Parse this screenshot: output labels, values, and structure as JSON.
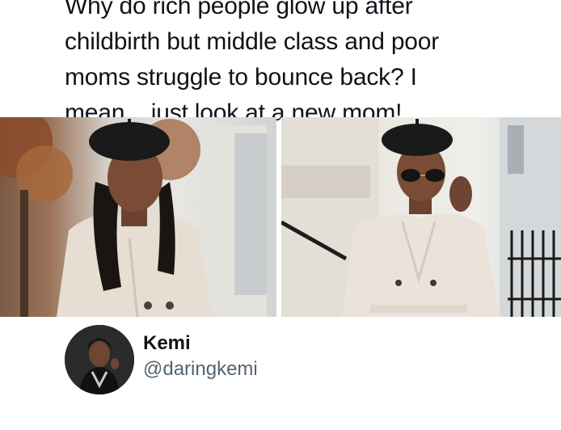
{
  "tweet": {
    "text_lines": [
      "Why do rich people glow up after",
      "childbirth but middle class and poor",
      "moms struggle to bounce back? I",
      "mean... just look at a new mom!"
    ]
  },
  "author": {
    "name": "Kemi",
    "handle": "@daringkemi"
  }
}
